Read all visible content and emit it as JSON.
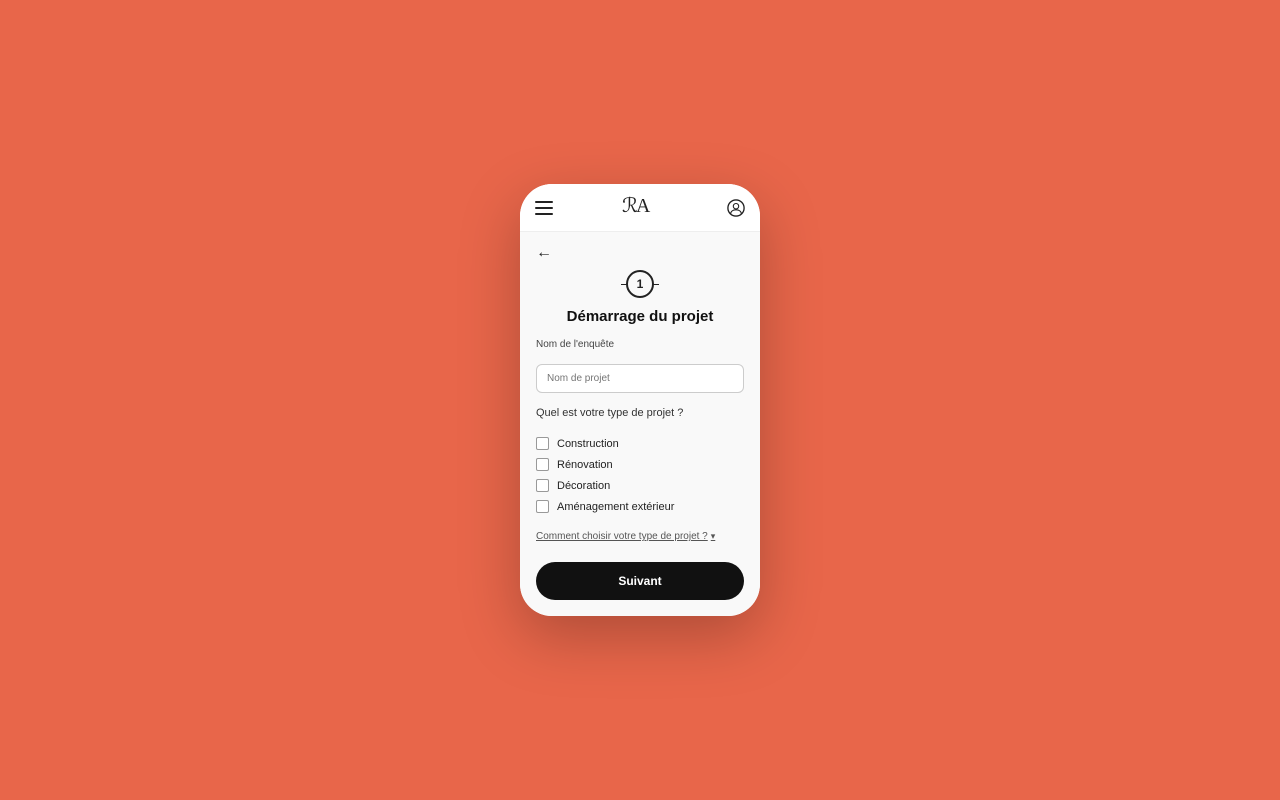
{
  "background_color": "#E8664A",
  "phone": {
    "nav": {
      "hamburger_label": "menu",
      "logo_text": "RA",
      "user_label": "user profile"
    },
    "back_button_label": "←",
    "step": {
      "number": "1",
      "label": "Step 1"
    },
    "page_title": "Démarrage du projet",
    "form": {
      "field_label": "Nom de l'enquête",
      "field_placeholder": "Nom de projet",
      "question": "Quel est votre type de projet ?",
      "checkboxes": [
        {
          "id": "construction",
          "label": "Construction"
        },
        {
          "id": "renovation",
          "label": "Rénovation"
        },
        {
          "id": "decoration",
          "label": "Décoration"
        },
        {
          "id": "amenagement",
          "label": "Aménagement extérieur"
        }
      ],
      "help_link": "Comment choisir votre type de projet ?",
      "submit_label": "Suivant"
    }
  }
}
